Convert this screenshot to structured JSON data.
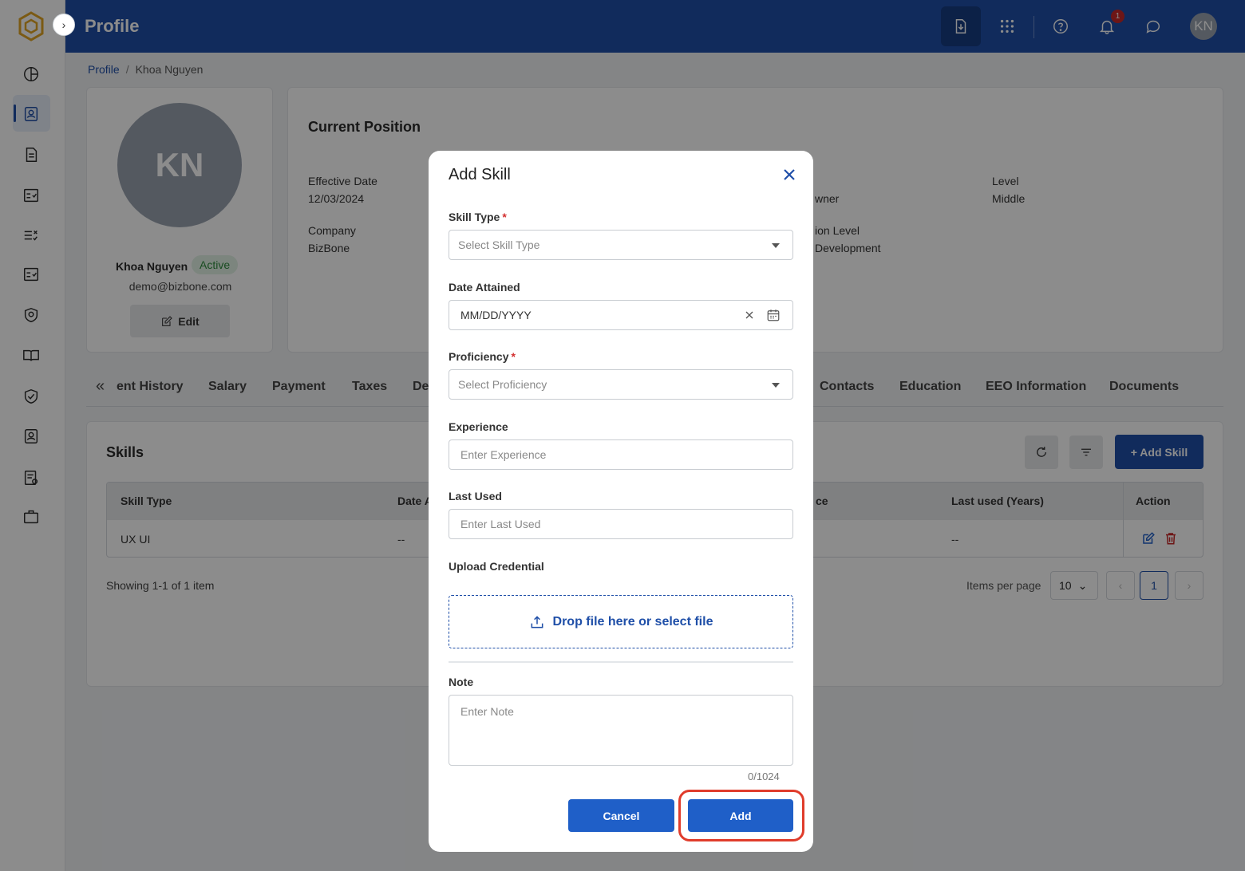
{
  "header": {
    "title": "Profile",
    "notification_count": "1",
    "user_initials": "KN"
  },
  "breadcrumb": {
    "root": "Profile",
    "separator": "/",
    "current": "Khoa Nguyen"
  },
  "profile": {
    "initials": "KN",
    "name": "Khoa Nguyen",
    "status": "Active",
    "email": "demo@bizbone.com",
    "edit_label": "Edit"
  },
  "position": {
    "title": "Current Position",
    "effective_date_label": "Effective Date",
    "effective_date_value": "12/03/2024",
    "company_label": "Company",
    "company_value": "BizBone",
    "owner_partial": "wner",
    "level_partial_label": "ion Level",
    "level_partial_value": "Development",
    "level_label": "Level",
    "level_value": "Middle"
  },
  "tabs": [
    "ent History",
    "Salary",
    "Payment",
    "Taxes",
    "De",
    "Contacts",
    "Education",
    "EEO Information",
    "Documents"
  ],
  "skills": {
    "title": "Skills",
    "add_label": "+ Add Skill",
    "columns": [
      "Skill Type",
      "Date A",
      "ce",
      "Last used (Years)",
      "Action"
    ],
    "rows": [
      {
        "skill_type": "UX UI",
        "date": "--",
        "last_used": "--"
      }
    ],
    "showing": "Showing 1-1 of 1 item",
    "items_per_page_label": "Items per page",
    "items_per_page": "10",
    "current_page": "1"
  },
  "modal": {
    "title": "Add Skill",
    "skill_type_label": "Skill Type",
    "skill_type_placeholder": "Select Skill Type",
    "date_label": "Date Attained",
    "date_placeholder": "MM/DD/YYYY",
    "proficiency_label": "Proficiency",
    "proficiency_placeholder": "Select Proficiency",
    "experience_label": "Experience",
    "experience_placeholder": "Enter Experience",
    "last_used_label": "Last Used",
    "last_used_placeholder": "Enter Last Used",
    "upload_label": "Upload Credential",
    "upload_text": "Drop file here or select file",
    "note_label": "Note",
    "note_placeholder": "Enter Note",
    "char_count": "0/1024",
    "cancel_label": "Cancel",
    "add_label": "Add",
    "required_mark": "*"
  },
  "colors": {
    "primary": "#1f4fa8",
    "button": "#1f5fc8",
    "highlight": "#e03c2b",
    "active_badge": "#2e8b3d"
  }
}
